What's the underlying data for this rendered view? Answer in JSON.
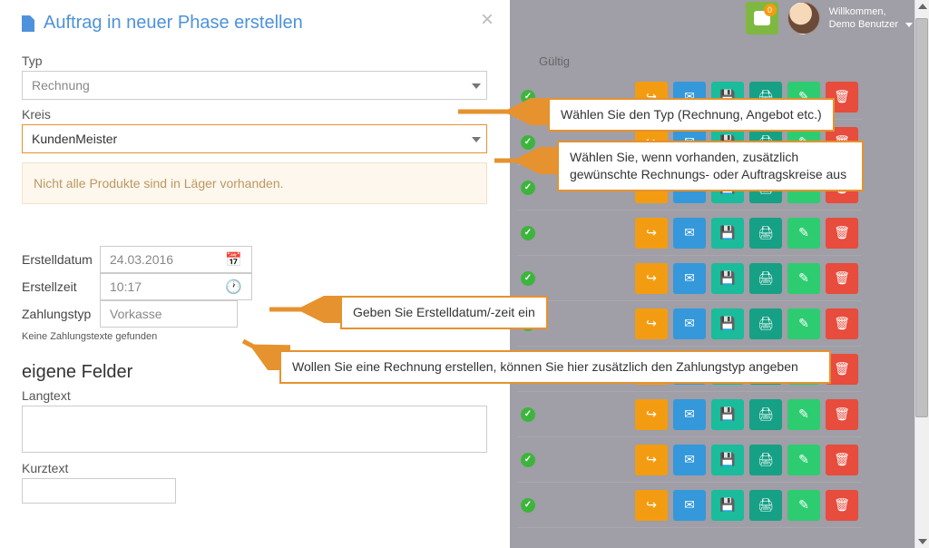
{
  "header": {
    "notif_count": "0",
    "welcome": "Willkommen,",
    "username": "Demo Benutzer"
  },
  "columns": {
    "valid": "Gültig"
  },
  "modal": {
    "title": "Auftrag in neuer Phase erstellen",
    "typ_label": "Typ",
    "typ_value": "Rechnung",
    "kreis_label": "Kreis",
    "kreis_value": "KundenMeister",
    "warning": "Nicht alle Produkte sind in Läger vorhanden.",
    "erstelldatum_label": "Erstelldatum",
    "erstelldatum_value": "24.03.2016",
    "erstellzeit_label": "Erstellzeit",
    "erstellzeit_value": "10:17",
    "zahlungstyp_label": "Zahlungstyp",
    "zahlungstyp_value": "Vorkasse",
    "zahlungshint": "Keine Zahlungstexte gefunden",
    "eigene_felder": "eigene Felder",
    "langtext_label": "Langtext",
    "kurztext_label": "Kurztext"
  },
  "callouts": {
    "c1": "Wählen Sie den Typ (Rechnung, Angebot etc.)",
    "c2": "Wählen Sie, wenn vorhanden, zusätzlich gewünschte Rechnungs- oder Auftragskreise aus",
    "c3": "Geben Sie Erstelldatum/-zeit ein",
    "c4": "Wollen Sie eine Rechnung erstellen, können Sie hier zusätzlich den Zahlungstyp angeben"
  },
  "actions": {
    "share": "↪",
    "envelope": "✉",
    "save": "💾",
    "print": "🖨",
    "edit": "✎",
    "delete": "🗑"
  }
}
